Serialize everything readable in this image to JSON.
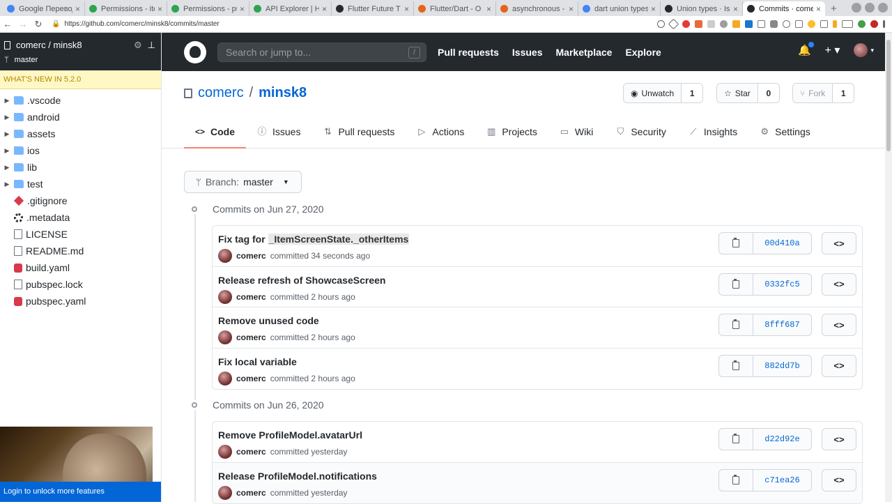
{
  "browser": {
    "tabs": [
      {
        "label": "Google Переводчик",
        "color": "#4285f4"
      },
      {
        "label": "Permissions - iterm",
        "color": "#2da44e"
      },
      {
        "label": "Permissions - pub",
        "color": "#2da44e"
      },
      {
        "label": "API Explorer | Hi",
        "color": "#2da44e"
      },
      {
        "label": "Flutter Future T",
        "color": "#24292e"
      },
      {
        "label": "Flutter/Dart - O",
        "color": "#e3641a"
      },
      {
        "label": "asynchronous -",
        "color": "#e3641a"
      },
      {
        "label": "dart union types",
        "color": "#4285f4"
      },
      {
        "label": "Union types · Iss",
        "color": "#24292e"
      },
      {
        "label": "Commits · comer",
        "color": "#24292e"
      }
    ],
    "url": "https://github.com/comerc/minsk8/commits/master"
  },
  "sidebar": {
    "repo": "comerc / minsk8",
    "branch": "master",
    "whats_new": "WHAT'S NEW IN 5.2.0",
    "tree": [
      {
        "name": ".vscode",
        "type": "folder"
      },
      {
        "name": "android",
        "type": "folder"
      },
      {
        "name": "assets",
        "type": "folder"
      },
      {
        "name": "ios",
        "type": "folder"
      },
      {
        "name": "lib",
        "type": "folder"
      },
      {
        "name": "test",
        "type": "folder"
      },
      {
        "name": ".gitignore",
        "type": "git"
      },
      {
        "name": ".metadata",
        "type": "cog"
      },
      {
        "name": "LICENSE",
        "type": "file"
      },
      {
        "name": "README.md",
        "type": "file"
      },
      {
        "name": "build.yaml",
        "type": "yaml"
      },
      {
        "name": "pubspec.lock",
        "type": "file"
      },
      {
        "name": "pubspec.yaml",
        "type": "yaml"
      }
    ],
    "login": "Login to unlock more features"
  },
  "header": {
    "search_placeholder": "Search or jump to...",
    "search_key": "/",
    "nav": [
      "Pull requests",
      "Issues",
      "Marketplace",
      "Explore"
    ]
  },
  "repo": {
    "owner": "comerc",
    "sep": "/",
    "name": "minsk8",
    "watch": {
      "label": "Unwatch",
      "count": "1"
    },
    "star": {
      "label": "Star",
      "count": "0"
    },
    "fork": {
      "label": "Fork",
      "count": "1"
    },
    "tabs": [
      {
        "label": "Code",
        "icon": "code-icon"
      },
      {
        "label": "Issues",
        "icon": "issue-icon"
      },
      {
        "label": "Pull requests",
        "icon": "pull-request-icon"
      },
      {
        "label": "Actions",
        "icon": "play-icon"
      },
      {
        "label": "Projects",
        "icon": "project-icon"
      },
      {
        "label": "Wiki",
        "icon": "book-icon"
      },
      {
        "label": "Security",
        "icon": "shield-icon"
      },
      {
        "label": "Insights",
        "icon": "graph-icon"
      },
      {
        "label": "Settings",
        "icon": "gear-icon"
      }
    ]
  },
  "branch_selector": {
    "prefix": "Branch:",
    "value": "master"
  },
  "commit_groups": [
    {
      "date": "Commits on Jun 27, 2020",
      "commits": [
        {
          "msg_prefix": "Fix tag for ",
          "msg_highlight": "_ItemScreenState._otherItems",
          "author": "comerc",
          "when": "committed 34 seconds ago",
          "sha": "00d410a"
        },
        {
          "msg_prefix": "Release refresh of ShowcaseScreen",
          "msg_highlight": "",
          "author": "comerc",
          "when": "committed 2 hours ago",
          "sha": "0332fc5"
        },
        {
          "msg_prefix": "Remove unused code",
          "msg_highlight": "",
          "author": "comerc",
          "when": "committed 2 hours ago",
          "sha": "8fff687"
        },
        {
          "msg_prefix": "Fix local variable",
          "msg_highlight": "",
          "author": "comerc",
          "when": "committed 2 hours ago",
          "sha": "882dd7b"
        }
      ]
    },
    {
      "date": "Commits on Jun 26, 2020",
      "commits": [
        {
          "msg_prefix": "Remove ProfileModel.avatarUrl",
          "msg_highlight": "",
          "author": "comerc",
          "when": "committed yesterday",
          "sha": "d22d92e"
        },
        {
          "msg_prefix": "Release ProfileModel.notifications",
          "msg_highlight": "",
          "author": "comerc",
          "when": "committed yesterday",
          "sha": "c71ea26"
        }
      ]
    }
  ],
  "colors": {
    "header_bg": "#24292e",
    "link": "#0366d6",
    "selected_tab_underline": "#f9826c",
    "news_bg": "#fff8c5",
    "login_bg": "#0366d6"
  }
}
